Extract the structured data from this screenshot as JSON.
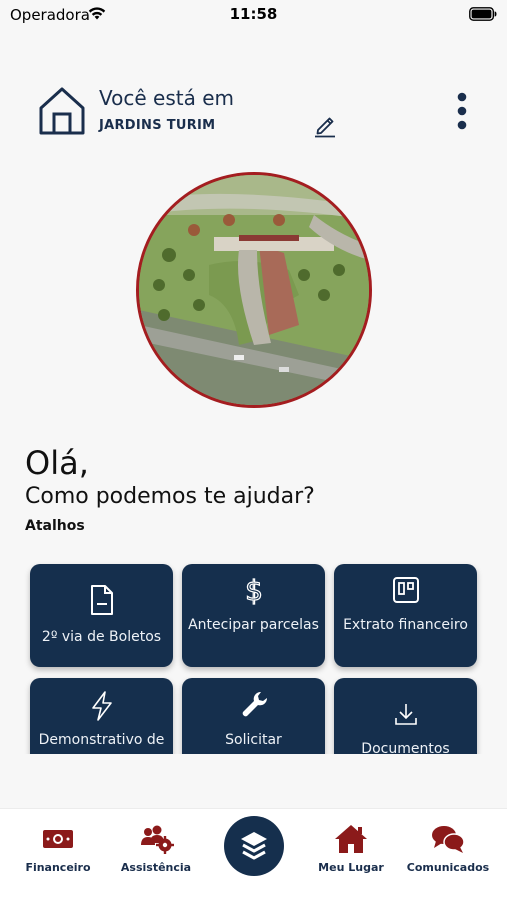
{
  "status_bar": {
    "carrier": "Operadora",
    "time": "11:58"
  },
  "location": {
    "prefix": "Você está em",
    "name": "JARDINS TURIM"
  },
  "greeting": {
    "title": "Olá,",
    "subtitle": "Como podemos te ajudar?"
  },
  "shortcuts": {
    "title": "Atalhos",
    "items": [
      {
        "label": "2º via de Boletos",
        "icon": "document-minus-icon"
      },
      {
        "label": "Antecipar parcelas",
        "icon": "dollar-icon"
      },
      {
        "label": "Extrato financeiro",
        "icon": "statement-icon"
      },
      {
        "label": "Demonstrativo de",
        "icon": "lightning-icon"
      },
      {
        "label": "Solicitar",
        "icon": "wrench-icon"
      },
      {
        "label": "Documentos",
        "icon": "download-icon"
      }
    ]
  },
  "tab_bar": {
    "items": [
      {
        "label": "Financeiro",
        "icon": "money-icon"
      },
      {
        "label": "Assistência",
        "icon": "people-gear-icon"
      },
      {
        "label": "Meu Lugar",
        "icon": "home-icon"
      },
      {
        "label": "Comunicados",
        "icon": "chat-icon"
      }
    ],
    "center_icon": "layers-icon"
  },
  "colors": {
    "primary": "#152f4d",
    "accent": "#8b1a1a",
    "photo_border": "#a41d20",
    "background": "#f7f7f7"
  }
}
